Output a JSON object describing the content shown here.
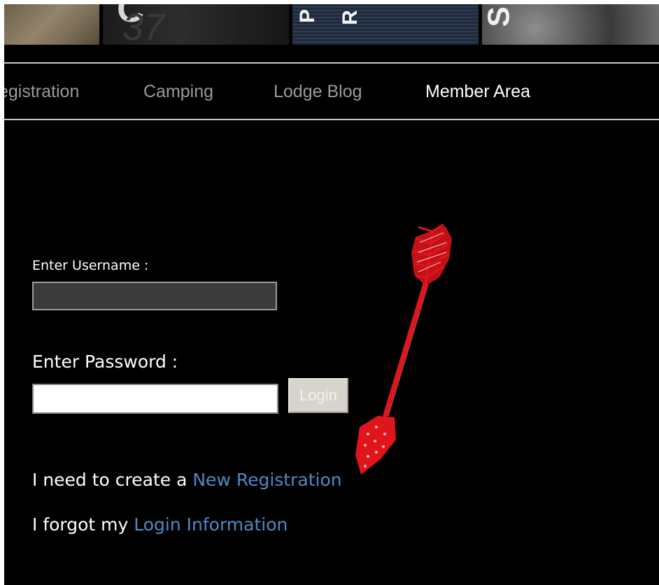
{
  "nav": {
    "items": [
      {
        "label": "egistration",
        "active": false
      },
      {
        "label": "Camping",
        "active": false
      },
      {
        "label": "Lodge Blog",
        "active": false
      },
      {
        "label": "Member Area",
        "active": true
      }
    ]
  },
  "banner": {
    "tiles": [
      {
        "glyphs": []
      },
      {
        "glyphs": [
          "C",
          "37"
        ]
      },
      {
        "glyphs": [
          "P",
          "R"
        ]
      },
      {
        "glyphs": [
          "S"
        ]
      }
    ]
  },
  "login_form": {
    "username_label": "Enter Username :",
    "username_value": "",
    "password_label": "Enter Password :",
    "password_value": "",
    "login_button": "Login"
  },
  "links": {
    "registration_prefix": "I need to create a ",
    "registration_link": "New Registration",
    "forgot_prefix": "I forgot my ",
    "forgot_link": "Login Information"
  },
  "colors": {
    "background": "#000000",
    "link": "#4f8ac4",
    "nav_inactive": "#9a9a9a",
    "nav_active": "#ffffff",
    "arrow": "#e0141b"
  }
}
